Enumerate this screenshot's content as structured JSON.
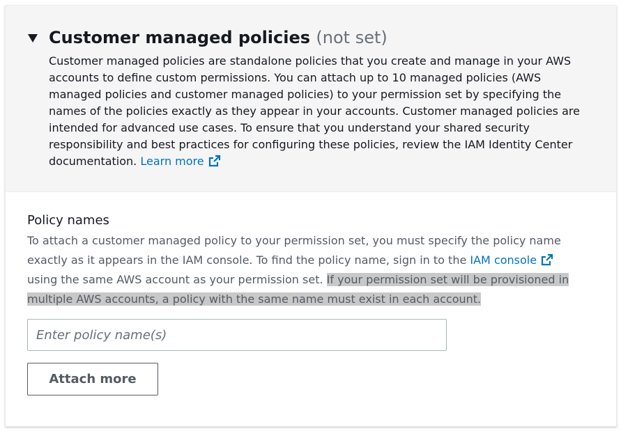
{
  "section": {
    "title": "Customer managed policies",
    "counter": "(not set)",
    "description": "Customer managed policies are standalone policies that you create and manage in your AWS accounts to define custom permissions. You can attach up to 10 managed policies (AWS managed policies and customer managed policies) to your permission set by specifying the names of the policies exactly as they appear in your accounts. Customer managed policies are intended for advanced use cases. To ensure that you understand your shared security responsibility and best practices for configuring these policies, review the IAM Identity Center documentation.",
    "learn_more": "Learn more"
  },
  "field": {
    "label": "Policy names",
    "desc_part1": "To attach a customer managed policy to your permission set, you must specify the policy name exactly as it appears in the IAM console. To find the policy name, sign in to the",
    "console_link": "IAM console",
    "desc_part2": "using the same AWS account as your permission set.",
    "desc_highlight": "If your permission set will be provisioned in multiple AWS accounts, a policy with the same name must exist in each account.",
    "input_value": "",
    "input_placeholder": "Enter policy name(s)"
  },
  "actions": {
    "attach_more": "Attach more"
  },
  "icons": {
    "expand": "caret-down-icon",
    "external": "external-link-icon"
  },
  "colors": {
    "link": "#0073bb",
    "header_bg": "#f5f5f5",
    "highlight": "#c8c8c8",
    "secondary_text": "#545b64"
  }
}
